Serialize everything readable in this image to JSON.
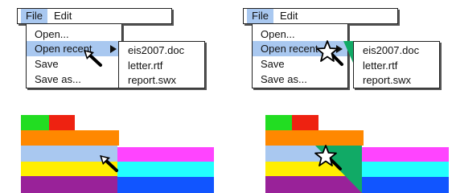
{
  "menubar": {
    "file_label": "File",
    "edit_label": "Edit"
  },
  "file_menu": {
    "items": [
      {
        "label": "Open..."
      },
      {
        "label": "Open recent",
        "highlighted": true,
        "has_submenu": true
      },
      {
        "label": "Save"
      },
      {
        "label": "Save as..."
      }
    ]
  },
  "recent_submenu": {
    "items": [
      {
        "label": "eis2007.doc"
      },
      {
        "label": "letter.rtf"
      },
      {
        "label": "report.swx"
      }
    ]
  },
  "colors": {
    "green": "#22dd22",
    "red": "#ee2211",
    "orange": "#ff8800",
    "light_blue": "#a9c8f0",
    "yellow": "#ffee00",
    "purple": "#992299",
    "magenta": "#ff44ff",
    "cyan": "#22ffff",
    "blue": "#1155ff",
    "teal_triangle": "#11aa66"
  },
  "icons": [
    "arrow-cursor-icon",
    "star-cursor-icon",
    "submenu-arrow-icon"
  ]
}
